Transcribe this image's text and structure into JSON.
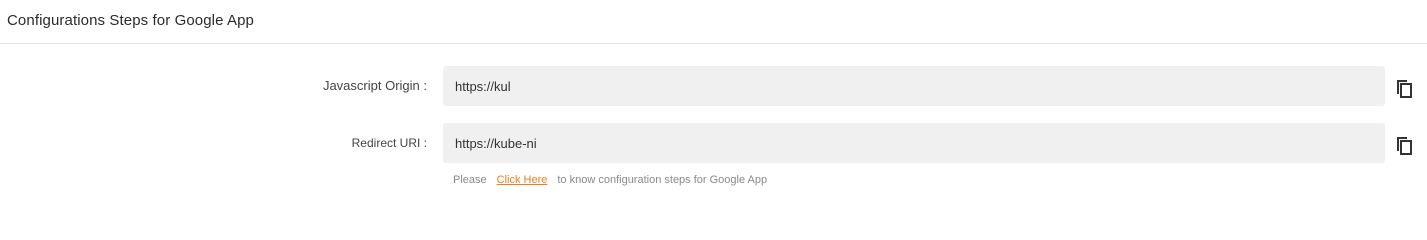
{
  "header": {
    "title": "Configurations Steps for Google App"
  },
  "fields": {
    "origin": {
      "label": "Javascript Origin :",
      "value": "https://kul"
    },
    "redirect": {
      "label": "Redirect URI :",
      "value": "https://kube-ni"
    }
  },
  "help": {
    "prefix": "Please",
    "link_label": "Click Here",
    "suffix": "to know configuration steps for Google App"
  },
  "icons": {
    "copy": "copy-icon"
  },
  "colors": {
    "link": "#f07c1e",
    "input_bg": "#f0f0f0"
  }
}
